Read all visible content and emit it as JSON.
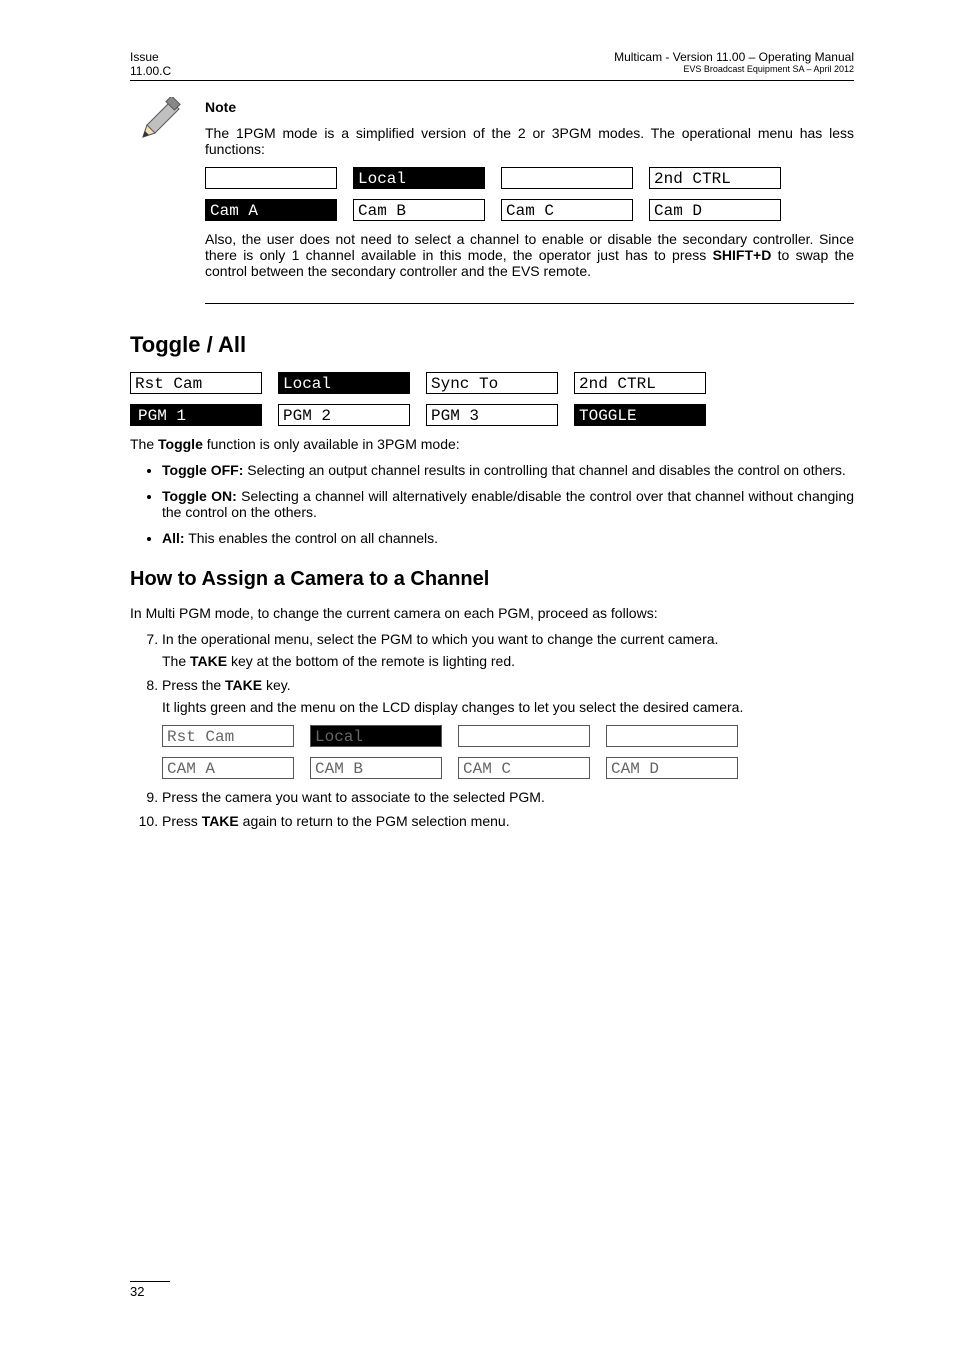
{
  "header": {
    "issue": "Issue",
    "issue_no": "11.00.C",
    "title": "Multicam - Version 11.00 – Operating Manual",
    "subtitle": "EVS Broadcast Equipment SA – April 2012"
  },
  "note": {
    "heading": "Note",
    "p1": "The 1PGM mode is a simplified version of the 2 or 3PGM modes. The operational menu has less functions:",
    "row1": {
      "c1": "",
      "c2": "Local",
      "c3": "",
      "c4": "2nd CTRL"
    },
    "row2": {
      "c1": "Cam A",
      "c2": "Cam B",
      "c3": "Cam C",
      "c4": "Cam D"
    },
    "p2a": "Also, the user does not need to select a channel to enable or disable the secondary controller. Since there is only 1 channel available in this mode, the operator just has to press ",
    "p2b": "SHIFT+D",
    "p2c": " to swap the control between the secondary controller and the EVS remote."
  },
  "toggle": {
    "heading": "Toggle / All",
    "row1": {
      "c1": "Rst Cam",
      "c2": "Local",
      "c3": "Sync To",
      "c4": "2nd CTRL"
    },
    "row2": {
      "c1": "PGM 1",
      "c2": "PGM 2",
      "c3": "PGM 3",
      "c4": "TOGGLE"
    },
    "intro_a": "The ",
    "intro_b": "Toggle",
    "intro_c": " function is only available in 3PGM mode:",
    "b1_a": "Toggle OFF:",
    "b1_b": " Selecting an output channel results in controlling that channel and disables the control on others.",
    "b2_a": "Toggle ON:",
    "b2_b": " Selecting a channel will alternatively enable/disable the control over that channel without changing the control on the others.",
    "b3_a": "All:",
    "b3_b": " This enables the control on all channels."
  },
  "assign": {
    "heading": "How to Assign a Camera to a Channel",
    "intro": "In Multi PGM mode, to change the current camera on each PGM, proceed as follows:",
    "s7": "In the operational menu, select the PGM to which you want to change the current camera.",
    "s7b_a": "The ",
    "s7b_b": "TAKE",
    "s7b_c": " key at the bottom of the remote is lighting red.",
    "s8_a": "Press the ",
    "s8_b": "TAKE",
    "s8_c": " key.",
    "s8d": "It lights green and the menu on the LCD display changes to let you select the desired camera.",
    "row1": {
      "c1": "Rst Cam",
      "c2": "Local",
      "c3": "",
      "c4": ""
    },
    "row2": {
      "c1": "CAM A",
      "c2": "CAM B",
      "c3": "CAM C",
      "c4": "CAM D"
    },
    "s9": "Press the camera you want to associate to the selected PGM.",
    "s10_a": "Press ",
    "s10_b": "TAKE",
    "s10_c": " again to return to the PGM selection menu."
  },
  "page_no": "32"
}
